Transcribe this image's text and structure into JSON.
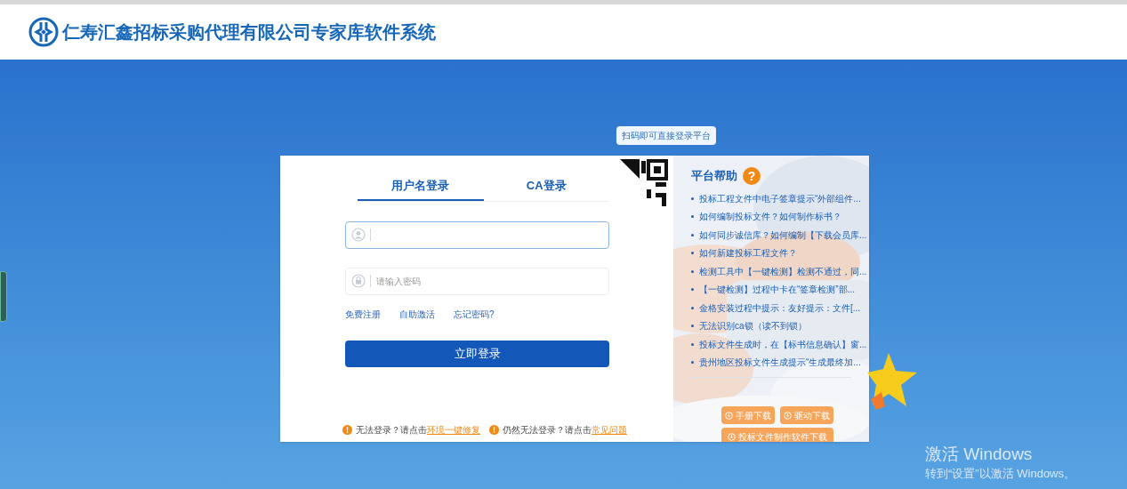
{
  "header": {
    "title": "仁寿汇鑫招标采购代理有限公司专家库软件系统"
  },
  "qr_tooltip": "扫码即可直接登录平台",
  "tabs": [
    {
      "label": "用户名登录",
      "selected": true
    },
    {
      "label": "CA登录",
      "selected": false
    }
  ],
  "fields": [
    {
      "kind": "user",
      "focused": true
    },
    {
      "kind": "password",
      "placeholder": "请输入密码",
      "focused": false
    }
  ],
  "links": [
    "免费注册",
    "自助激活",
    "忘记密码?"
  ],
  "login_button": "立即登录",
  "notes": [
    {
      "text": "无法登录？请点击",
      "link": "环境一键修复"
    },
    {
      "text": "仍然无法登录？请点击",
      "link": "常见问题"
    }
  ],
  "help": {
    "title": "平台帮助",
    "icon": "?",
    "items": [
      "投标工程文件中电子签章提示“外部组件...",
      "如何编制投标文件？如何制作标书？",
      "如何同步诚信库？如何编制【下载会员库...",
      "如何新建投标工程文件？",
      "检测工具中【一键检测】检测不通过，同...",
      "【一键检测】过程中卡在“签章检测”部...",
      "金格安装过程中提示：友好提示：文件[...",
      "无法识别ca锁（读不到锁）",
      "投标文件生成时，在【标书信息确认】窗...",
      "贵州地区投标文件生成提示“生成最终加..."
    ]
  },
  "downloads": [
    "手册下载",
    "驱动下载",
    "投标文件制作软件下载"
  ],
  "windows_notice": {
    "title": "激活 Windows",
    "text": "转到“设置”以激活 Windows。"
  }
}
